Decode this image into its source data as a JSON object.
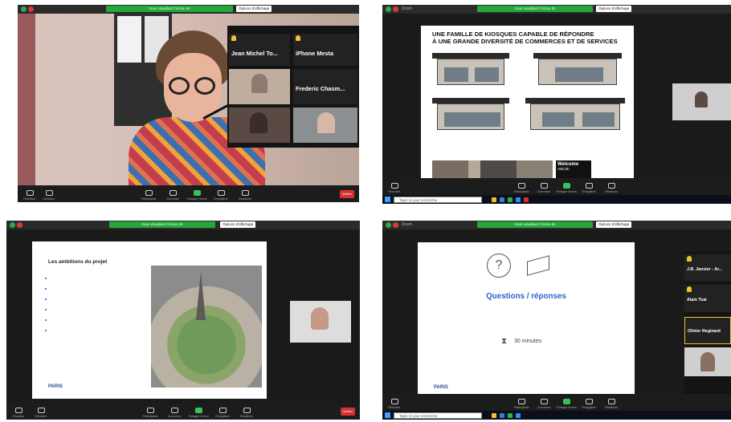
{
  "app": {
    "title": "Zoom"
  },
  "toolbar": {
    "recording_label": "Vous visualisez l'écran de ",
    "view_options": "Options d'affichage",
    "controls": [
      {
        "label": "Réactiver",
        "icon": "microphone-icon"
      },
      {
        "label": "Démarrer",
        "icon": "video-icon"
      },
      {
        "label": "Participants",
        "icon": "participants-icon"
      },
      {
        "label": "Converser",
        "icon": "chat-icon"
      },
      {
        "label": "Partager l'écran",
        "icon": "share-screen-icon"
      },
      {
        "label": "Enregistrer",
        "icon": "record-icon"
      },
      {
        "label": "Réactions",
        "icon": "reactions-icon"
      }
    ],
    "end_label": "Quitter"
  },
  "taskbar": {
    "search_placeholder": "Taper ici pour rechercher"
  },
  "window1": {
    "panel_header": "Galerie",
    "tiles": [
      {
        "name": "Jean Michel To..."
      },
      {
        "name": "iPhone Mesta"
      },
      {
        "name": "Frederic Chasm..."
      }
    ]
  },
  "window2": {
    "slide_title_line1": "UNE FAMILLE DE KIOSQUES CAPABLE DE RÉPONDRE",
    "slide_title_line2": "À UNE GRANDE DIVERSITÉ DE COMMERCES ET DE SERVICES",
    "brand_line1": "Welcome",
    "brand_line2": "ABCdn"
  },
  "window3": {
    "slide_title": "Les ambitions du projet",
    "logo": "PARIS"
  },
  "window4": {
    "title": "Questions / réponses",
    "minutes": "30 minutes",
    "logo": "PARIS",
    "tiles": [
      {
        "name": "J.B. Janvier - Ar..."
      },
      {
        "name": "Alain Tsai"
      },
      {
        "name": "Olivier Reginard"
      }
    ]
  },
  "colors": {
    "accent_blue": "#2f5fd0",
    "record_green": "#23a83a",
    "end_red": "#d8302f"
  }
}
